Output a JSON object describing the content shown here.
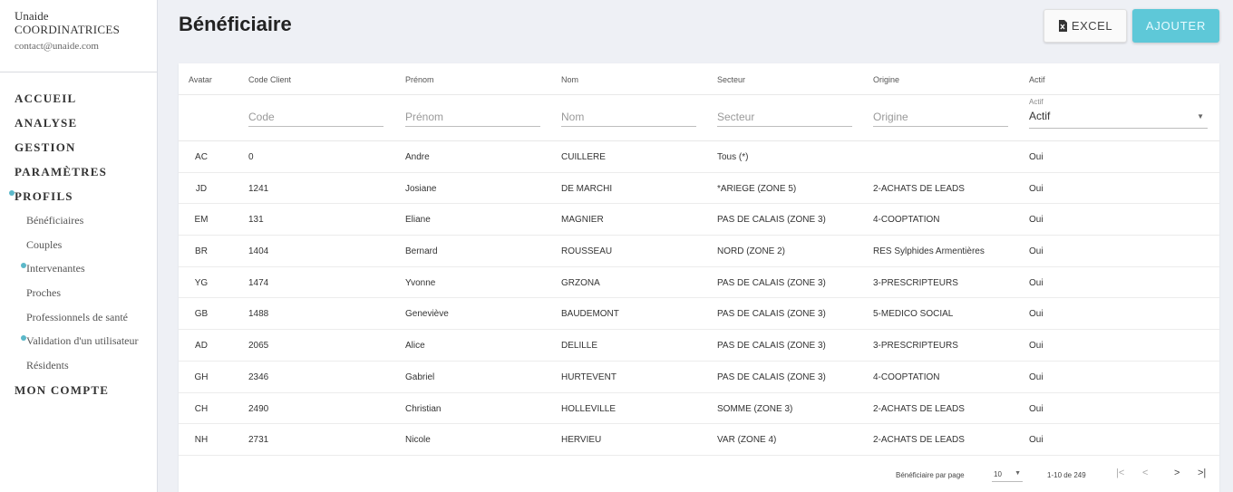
{
  "sidebar": {
    "org": "Unaide",
    "role": "COORDINATRICES",
    "email": "contact@unaide.com",
    "nav": [
      {
        "label": "ACCUEIL",
        "level": "top",
        "dot": false
      },
      {
        "label": "ANALYSE",
        "level": "top",
        "dot": false
      },
      {
        "label": "GESTION",
        "level": "top",
        "dot": false
      },
      {
        "label": "PARAMÈTRES",
        "level": "top",
        "dot": false
      },
      {
        "label": "PROFILS",
        "level": "top",
        "dot": true
      },
      {
        "label": "Bénéficiaires",
        "level": "sub",
        "dot": false
      },
      {
        "label": "Couples",
        "level": "sub",
        "dot": false
      },
      {
        "label": "Intervenantes",
        "level": "sub",
        "dot": true
      },
      {
        "label": "Proches",
        "level": "sub",
        "dot": false
      },
      {
        "label": "Professionnels de santé",
        "level": "sub",
        "dot": false
      },
      {
        "label": "Validation d'un utilisateur",
        "level": "sub",
        "dot": true
      },
      {
        "label": "Résidents",
        "level": "sub",
        "dot": false
      },
      {
        "label": "MON COMPTE",
        "level": "top",
        "dot": false
      }
    ]
  },
  "header": {
    "title": "Bénéficiaire",
    "excel_label": "EXCEL",
    "add_label": "AJOUTER",
    "accent": "#5ec8d8"
  },
  "table": {
    "columns": {
      "avatar": "Avatar",
      "code": "Code Client",
      "prenom": "Prénom",
      "nom": "Nom",
      "secteur": "Secteur",
      "origine": "Origine",
      "actif": "Actif"
    },
    "filters": {
      "code_placeholder": "Code",
      "prenom_placeholder": "Prénom",
      "nom_placeholder": "Nom",
      "secteur_placeholder": "Secteur",
      "origine_placeholder": "Origine",
      "actif_label": "Actif",
      "actif_value": "Actif"
    },
    "rows": [
      {
        "avatar": "AC",
        "code": "0",
        "prenom": "Andre",
        "nom": "CUILLERE",
        "secteur": "Tous (*)",
        "origine": "",
        "actif": "Oui"
      },
      {
        "avatar": "JD",
        "code": "1241",
        "prenom": "Josiane",
        "nom": "DE MARCHI",
        "secteur": "*ARIEGE (ZONE 5)",
        "origine": "2-ACHATS DE LEADS",
        "actif": "Oui"
      },
      {
        "avatar": "EM",
        "code": "131",
        "prenom": "Eliane",
        "nom": "MAGNIER",
        "secteur": "PAS DE CALAIS (ZONE 3)",
        "origine": "4-COOPTATION",
        "actif": "Oui"
      },
      {
        "avatar": "BR",
        "code": "1404",
        "prenom": "Bernard",
        "nom": "ROUSSEAU",
        "secteur": "NORD (ZONE 2)",
        "origine": "RES Sylphides Armentières",
        "actif": "Oui"
      },
      {
        "avatar": "YG",
        "code": "1474",
        "prenom": "Yvonne",
        "nom": "GRZONA",
        "secteur": "PAS DE CALAIS (ZONE 3)",
        "origine": "3-PRESCRIPTEURS",
        "actif": "Oui"
      },
      {
        "avatar": "GB",
        "code": "1488",
        "prenom": "Geneviève",
        "nom": "BAUDEMONT",
        "secteur": "PAS DE CALAIS (ZONE 3)",
        "origine": "5-MEDICO SOCIAL",
        "actif": "Oui"
      },
      {
        "avatar": "AD",
        "code": "2065",
        "prenom": "Alice",
        "nom": "DELILLE",
        "secteur": "PAS DE CALAIS (ZONE 3)",
        "origine": "3-PRESCRIPTEURS",
        "actif": "Oui"
      },
      {
        "avatar": "GH",
        "code": "2346",
        "prenom": "Gabriel",
        "nom": "HURTEVENT",
        "secteur": "PAS DE CALAIS (ZONE 3)",
        "origine": "4-COOPTATION",
        "actif": "Oui"
      },
      {
        "avatar": "CH",
        "code": "2490",
        "prenom": "Christian",
        "nom": "HOLLEVILLE",
        "secteur": "SOMME (ZONE 3)",
        "origine": "2-ACHATS DE LEADS",
        "actif": "Oui"
      },
      {
        "avatar": "NH",
        "code": "2731",
        "prenom": "Nicole",
        "nom": "HERVIEU",
        "secteur": "VAR (ZONE 4)",
        "origine": "2-ACHATS DE LEADS",
        "actif": "Oui"
      }
    ]
  },
  "pagination": {
    "per_page_label": "Bénéficiaire par page",
    "per_page_value": "10",
    "range": "1-10 de 249"
  },
  "icons": {
    "first": "first-page-icon",
    "prev": "prev-page-icon",
    "next": "next-page-icon",
    "last": "last-page-icon",
    "excel": "excel-icon",
    "dropdown": "chevron-down-icon"
  }
}
